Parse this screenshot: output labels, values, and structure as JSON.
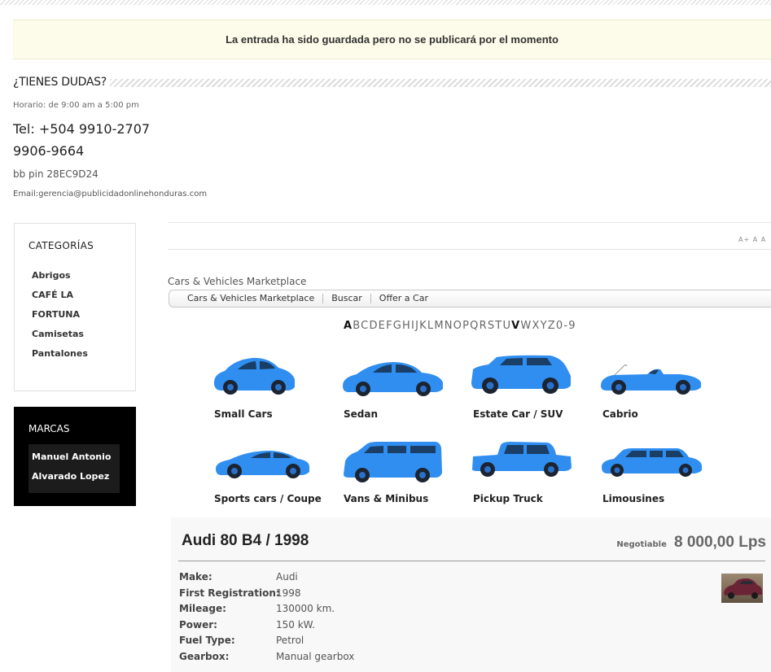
{
  "notice": {
    "message": "La entrada ha sido guardada pero no se publicará por el momento"
  },
  "contact": {
    "title": "¿TIENES DUDAS?",
    "hours": "Horario: de 9:00 am a 5:00 pm",
    "phone_line1": "Tel: +504 9910-2707",
    "phone_line2": "9906-9664",
    "bb_pin": "bb pin 28EC9D24",
    "email": "Email:gerencia@publicidadonlinehonduras.com"
  },
  "categories": {
    "title": "CATEGORÍAS",
    "items": [
      "Abrigos",
      "CAFÉ LA",
      "FORTUNA",
      "Camisetas",
      "Pantalones"
    ]
  },
  "brands": {
    "title": "MARCAS",
    "items": [
      "Manuel Antonio",
      "Alvarado Lopez"
    ]
  },
  "font_sizer": "A+ A  A",
  "marketplace": {
    "title": "Cars & Vehicles Marketplace",
    "menu": [
      "Cars & Vehicles Marketplace",
      "Buscar",
      "Offer a Car"
    ],
    "alphabet": [
      "A",
      "B",
      "C",
      "D",
      "E",
      "F",
      "G",
      "H",
      "I",
      "J",
      "K",
      "L",
      "M",
      "N",
      "O",
      "P",
      "Q",
      "R",
      "S",
      "T",
      "U",
      "V",
      "W",
      "X",
      "Y",
      "Z",
      "0-9"
    ],
    "alphabet_bold": [
      "A",
      "V"
    ]
  },
  "car_types": [
    {
      "label": "Small Cars",
      "icon": "small-car-icon"
    },
    {
      "label": "Sedan",
      "icon": "sedan-icon"
    },
    {
      "label": "Estate Car / SUV",
      "icon": "suv-icon"
    },
    {
      "label": "Cabrio",
      "icon": "cabrio-icon"
    },
    {
      "label": "Sports cars / Coupe",
      "icon": "sports-car-icon"
    },
    {
      "label": "Vans & Minibus",
      "icon": "van-icon"
    },
    {
      "label": "Pickup Truck",
      "icon": "pickup-truck-icon"
    },
    {
      "label": "Limousines",
      "icon": "limousine-icon"
    }
  ],
  "colors": {
    "car_blue": "#2f8ef0",
    "car_dark": "#1a5fb5"
  },
  "listing": {
    "title": "Audi 80 B4 / 1998",
    "negotiable": "Negotiable",
    "price": "8 000,00 Lps",
    "specs": [
      {
        "key": "Make:",
        "value": "Audi"
      },
      {
        "key": "First Registration:",
        "value": "1998"
      },
      {
        "key": "Mileage:",
        "value": "130000 km."
      },
      {
        "key": "Power:",
        "value": "150 kW."
      },
      {
        "key": "Fuel Type:",
        "value": "Petrol"
      },
      {
        "key": "Gearbox:",
        "value": "Manual gearbox"
      }
    ]
  }
}
